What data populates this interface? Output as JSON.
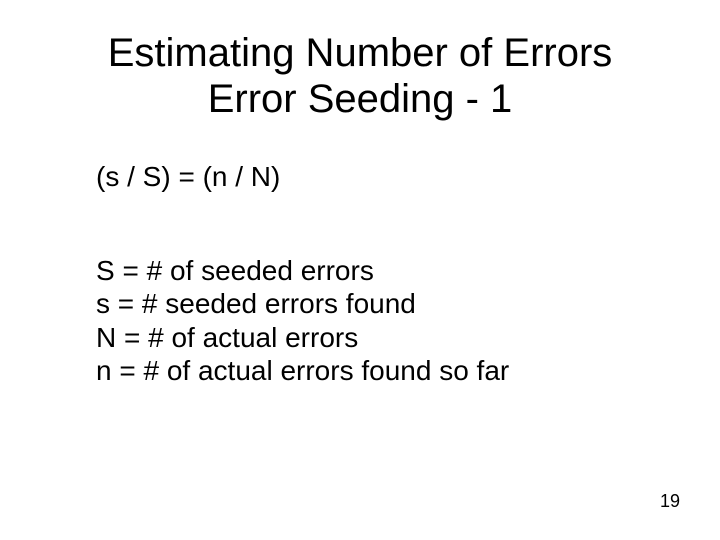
{
  "title_line1": "Estimating Number of Errors",
  "title_line2": "Error Seeding - 1",
  "equation": "(s / S) = (n / N)",
  "defs": {
    "S": "S = # of seeded errors",
    "s": "s = # seeded errors found",
    "N": "N = # of actual errors",
    "n": "n = # of actual errors found so far"
  },
  "page_number": "19"
}
